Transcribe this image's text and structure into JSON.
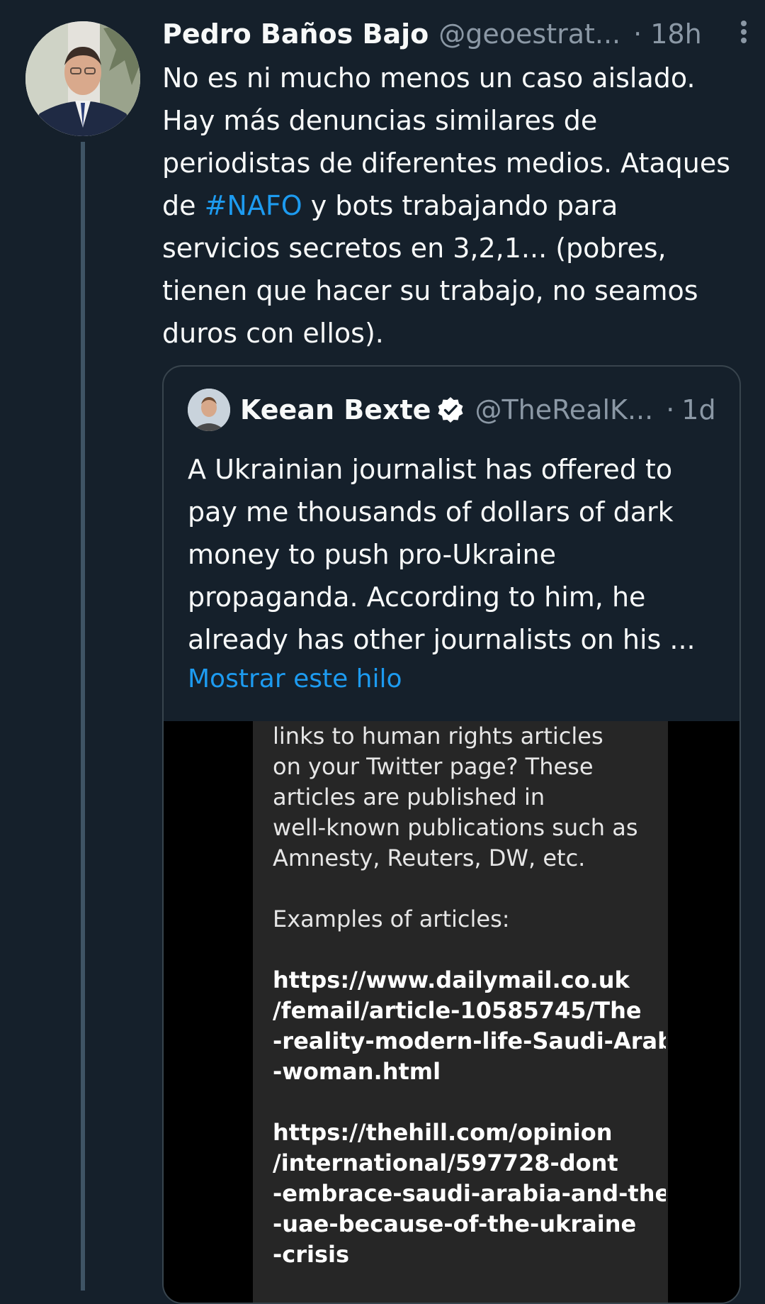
{
  "tweet": {
    "display_name": "Pedro Baños Bajo",
    "handle": "@geoestrat...",
    "separator": "·",
    "time": "18h",
    "text_before_hashtag": "No es ni mucho menos un caso aislado. Hay más denuncias similares de periodistas de diferentes medios. Ataques de ",
    "hashtag": "#NAFO",
    "text_after_hashtag": " y bots trabajando para servicios secretos en 3,2,1... (pobres, tienen que hacer su trabajo, no seamos duros con ellos)."
  },
  "quote": {
    "display_name": "Keean Bexte",
    "handle": "@TheRealK...",
    "separator": "·",
    "time": "1d",
    "text": "A Ukrainian journalist has offered to pay me thousands of dollars of dark money to push pro-Ukraine propaganda. According to him, he already has other journalists on his ...",
    "show_thread": "Mostrar este hilo"
  },
  "media_screenshot": {
    "paragraph_lines": [
      "links to human rights articles",
      "on your Twitter page? These",
      "articles are published in",
      "well-known publications such as",
      "Amnesty, Reuters, DW, etc."
    ],
    "examples_heading": "Examples of articles:",
    "link1_lines": [
      "https://www.dailymail.co.uk",
      "/femail/article-10585745/The",
      "-reality-modern-life-Saudi-Arabi",
      "-woman.html"
    ],
    "link2_lines": [
      "https://thehill.com/opinion",
      "/international/597728-dont",
      "-embrace-saudi-arabia-and-the",
      "-uae-because-of-the-ukraine",
      "-crisis"
    ]
  },
  "colors": {
    "background": "#15202b",
    "text": "#f7f9f9",
    "secondary_text": "#8b98a5",
    "accent": "#1d9bf0",
    "card_border": "#38444d"
  },
  "icons": {
    "more": "more-vertical-icon",
    "verified": "verified-badge-icon"
  }
}
